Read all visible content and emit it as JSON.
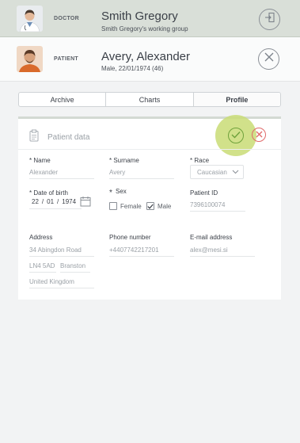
{
  "doctor": {
    "role_label": "DOCTOR",
    "name": "Smith Gregory",
    "group": "Smith Gregory's working group"
  },
  "patient": {
    "role_label": "PATIENT",
    "name": "Avery, Alexander",
    "details": "Male, 22/01/1974 (46)"
  },
  "tabs": [
    {
      "label": "Archive"
    },
    {
      "label": "Charts"
    },
    {
      "label": "Profile",
      "active": true
    }
  ],
  "card": {
    "title": "Patient data"
  },
  "form": {
    "name": {
      "label": "* Name",
      "value": "Alexander"
    },
    "surname": {
      "label": "* Surname",
      "value": "Avery"
    },
    "race": {
      "label": "* Race",
      "value": "Caucasian"
    },
    "dob": {
      "label": "* Date of birth",
      "day": "22",
      "month": "01",
      "year": "1974",
      "sep": "/"
    },
    "sex": {
      "label": "Sex",
      "star": "*",
      "female": "Female",
      "male": "Male",
      "female_checked": false,
      "male_checked": true
    },
    "patient_id": {
      "label": "Patient ID",
      "value": "7396100074"
    },
    "address": {
      "label": "Address",
      "line1": "34 Abingdon Road",
      "postcode": "LN4 5AD",
      "city": "Branston",
      "country": "United Kingdom"
    },
    "phone": {
      "label": "Phone number",
      "value": "+4407742217201"
    },
    "email": {
      "label": "E-mail address",
      "value": "alex@mesi.si"
    }
  },
  "colors": {
    "accent_glow": "#c9dc76",
    "confirm": "#6fa23c",
    "cancel": "#e06a6a",
    "doctor_bar": "#d9dfd8"
  }
}
